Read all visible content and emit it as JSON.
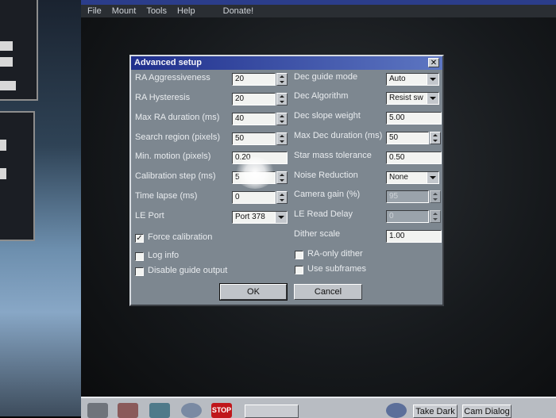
{
  "menubar": {
    "items": [
      "File",
      "Mount",
      "Tools",
      "Help",
      "Donate!"
    ]
  },
  "dialog": {
    "title": "Advanced setup",
    "close_glyph": "✕",
    "left": [
      {
        "label": "RA Aggressiveness",
        "value": "20",
        "kind": "spin"
      },
      {
        "label": "RA Hysteresis",
        "value": "20",
        "kind": "spin"
      },
      {
        "label": "Max RA duration (ms)",
        "value": "40",
        "kind": "spin"
      },
      {
        "label": "Search region (pixels)",
        "value": "50",
        "kind": "spin"
      },
      {
        "label": "Min. motion (pixels)",
        "value": "0.20",
        "kind": "text"
      },
      {
        "label": "Calibration step (ms)",
        "value": "5",
        "kind": "spin"
      },
      {
        "label": "Time lapse (ms)",
        "value": "0",
        "kind": "spin"
      },
      {
        "label": "LE Port",
        "value": "Port 378",
        "kind": "combo"
      }
    ],
    "right": [
      {
        "label": "Dec guide mode",
        "value": "Auto",
        "kind": "combo"
      },
      {
        "label": "Dec Algorithm",
        "value": "Resist sw",
        "kind": "combo"
      },
      {
        "label": "Dec slope weight",
        "value": "5.00",
        "kind": "text"
      },
      {
        "label": "Max Dec duration (ms)",
        "value": "50",
        "kind": "spin"
      },
      {
        "label": "Star mass tolerance",
        "value": "0.50",
        "kind": "text"
      },
      {
        "label": "Noise Reduction",
        "value": "None",
        "kind": "combo"
      },
      {
        "label": "Camera gain (%)",
        "value": "95",
        "kind": "spin-disabled"
      },
      {
        "label": "LE Read Delay",
        "value": "0",
        "kind": "spin-disabled"
      },
      {
        "label": "Dither scale",
        "value": "1.00",
        "kind": "text"
      }
    ],
    "checkboxes": {
      "force_calibration": {
        "label": "Force calibration",
        "checked": true,
        "mark": "✓"
      },
      "log_info": {
        "label": "Log info",
        "checked": false,
        "mark": ""
      },
      "disable_guide_output": {
        "label": "Disable guide output",
        "checked": false,
        "mark": ""
      },
      "ra_only_dither": {
        "label": "RA-only dither",
        "checked": false,
        "mark": ""
      },
      "use_subframes": {
        "label": "Use subframes",
        "checked": false,
        "mark": ""
      }
    },
    "buttons": {
      "ok": "OK",
      "cancel": "Cancel"
    }
  },
  "taskbar": {
    "stop_label": "STOP",
    "take_dark_label": "Take Dark",
    "cam_dialog_label": "Cam Dialog"
  }
}
